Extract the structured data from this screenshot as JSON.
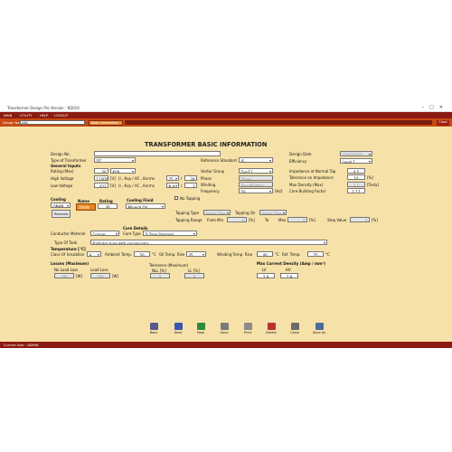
{
  "window": {
    "title": "Transformer Design Pro Version : N2010"
  },
  "menu": [
    "MAIN",
    "UTILITY",
    "HELP",
    "LOGOUT"
  ],
  "subbar": {
    "design_label": "Design No:",
    "design_value": "ABC",
    "tab": "Basic Information",
    "close": "Close"
  },
  "heading": "TRANSFORMER BASIC INFORMATION",
  "left": {
    "design_no_label": "Design No.",
    "type_label": "Type of Transformer",
    "type_value": "DT",
    "general_inputs": "General Inputs",
    "rating_label": "Rating (Max)",
    "rating_value": "30",
    "rating_unit": "KVA",
    "hv_label": "High Voltage",
    "hv_value": "11000",
    "hv_unit": "[V]",
    "hv_conn": "(I , Kvp / AC , Kvrms",
    "hv_conn_value": "75",
    "lv_label": "Low Voltage",
    "lv_value": "433",
    "lv_unit": "[V]",
    "lv_conn": "(I , Kvp / AC , Kvrms",
    "lv_conn_value": "N.A",
    "slash1": "/",
    "bil1": "28",
    "slash2": "/",
    "bil2": "3"
  },
  "middle": {
    "ref_std_label": "Reference Standard",
    "ref_std_value": "IS",
    "vector_label": "Vector Group",
    "vector_value": "Dyn11",
    "phase_label": "Phase",
    "phase_value": "Three",
    "winding_label": "Winding",
    "winding_value": "Two Winding",
    "freq_label": "Frequency",
    "freq_value": "50",
    "freq_unit": "[Hz]"
  },
  "right": {
    "date_label": "Design Date",
    "date_value": "27/07/2021",
    "eff_label": "Efficiency",
    "eff_value": "Level 1",
    "imp_label": "Impedance at Normal Tap",
    "imp_value": "4.5",
    "tol_label": "Tolerance on Impedance",
    "tol_value": "10",
    "tol_unit": "[%]",
    "flux_label": "Max Density (Max)",
    "flux_value": "1.5",
    "flux_unit": "[Tesla]",
    "core_label": "Core Building Factor",
    "core_value": "1.17"
  },
  "cooling": {
    "cooling_label": "Cooling",
    "cooling_value": "ONAN",
    "name_label": "Name",
    "name_value": "ONAN",
    "rating_label": "Rating",
    "rating_value": "30",
    "remove": "Remove",
    "fluid_label": "Cooling Fluid",
    "fluid_value": "Mineral Oil",
    "no_tapping": "No Tapping"
  },
  "tapping": {
    "type_label": "Tapping Type",
    "type_value": "Select One",
    "on_label": "Tapping On",
    "on_value": "Select One",
    "range_label": "Tapping Range",
    "from_label": "From",
    "min_label": "Min",
    "from_value": "0",
    "pct1": "[%]",
    "to_label": "To",
    "max_label": "Max",
    "to_value": "0",
    "pct2": "[%]",
    "step_label": "Step Value",
    "step_value": "0",
    "pct3": "[%]"
  },
  "conductor": {
    "label": "Conductor Material",
    "value": "Copper",
    "core_details": "Core Details",
    "core_type_label": "Core Type",
    "core_type_value": "D Type Stepped"
  },
  "tank": {
    "label": "Type Of Tank",
    "value": "Radiator type with conservator"
  },
  "temperature": {
    "heading": "Temperature [°C]",
    "class_label": "Class Of Insulation",
    "class_value": "A",
    "ambient_label": "Ambient Temp.",
    "ambient_value": "50",
    "unit1": "°C",
    "oil_label": "Oil Temp. Rise",
    "oil_value": "35",
    "wind_label": "Winding Temp. Rise",
    "wind_value": "40",
    "unit2": "°C",
    "ref_label": "Ref. Temp.",
    "ref_value": "75",
    "unit3": "°C"
  },
  "losses": {
    "heading": "Losses (Maximum)",
    "nl_label": "No Load Loss",
    "nl_value": "100",
    "nl_unit": "[W]",
    "ll_label": "Load Loss",
    "ll_value": "760",
    "ll_unit": "[W]",
    "tol_heading": "Tolerance (Maximum)",
    "nl_pct_label": "NLL [%]",
    "nl_pct_value": "0",
    "ll_pct_label": "LL [%]",
    "ll_pct_value": "0",
    "density_heading": "Max Current Density (Amp / mm²)",
    "lv_label": "LV",
    "lv_value": "2.8",
    "hv_label": "HV",
    "hv_value": "2.8"
  },
  "toolbar": [
    {
      "label": "Back",
      "icon": "back-arrow-icon",
      "color": "#5a5a8a"
    },
    {
      "label": "Next",
      "icon": "next-arrow-icon",
      "color": "#3a56b0"
    },
    {
      "label": "New",
      "icon": "new-file-icon",
      "color": "#2e8a3a"
    },
    {
      "label": "Save",
      "icon": "save-disk-icon",
      "color": "#7a7a7a"
    },
    {
      "label": "Print",
      "icon": "printer-icon",
      "color": "#8a8a8a"
    },
    {
      "label": "Delete",
      "icon": "delete-icon",
      "color": "#b83030"
    },
    {
      "label": "Close",
      "icon": "close-icon",
      "color": "#6a6a6a"
    },
    {
      "label": "Save As",
      "icon": "save-as-icon",
      "color": "#4a6a9a"
    }
  ],
  "status": "Current User : ADMIN"
}
